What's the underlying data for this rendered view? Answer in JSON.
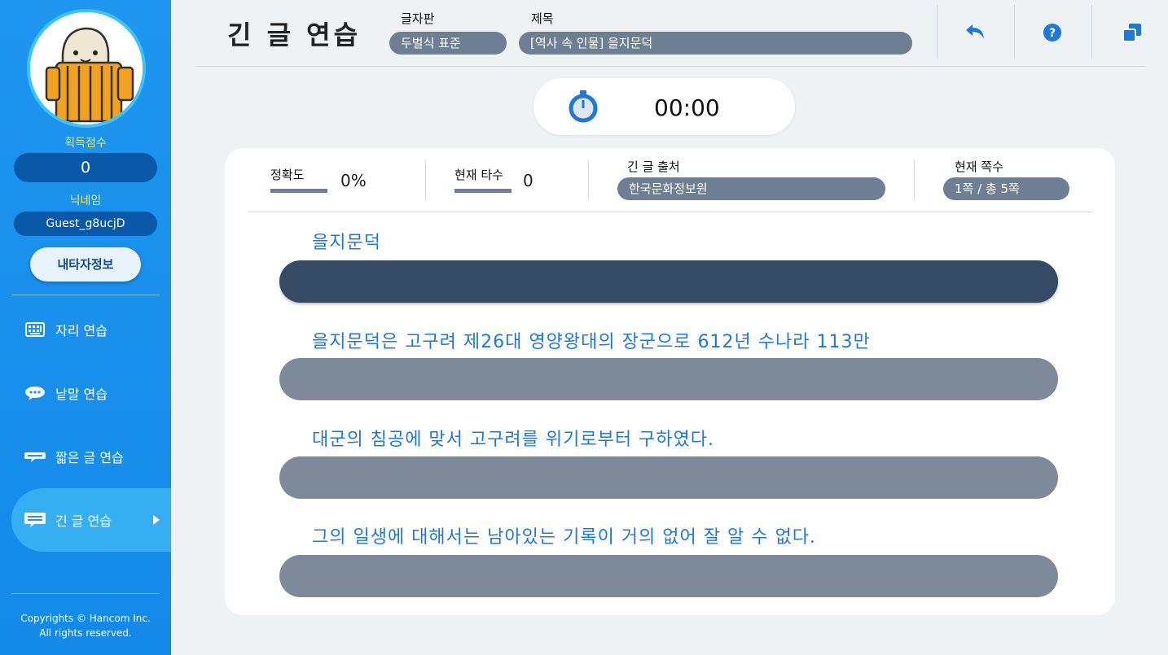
{
  "sidebar": {
    "score_label": "획득점수",
    "score_value": "0",
    "nick_label": "닉네임",
    "nick_value": "Guest_g8ucjD",
    "myinfo_label": "내타자정보",
    "nav": [
      {
        "label": "자리 연습",
        "icon": "keyboard-icon"
      },
      {
        "label": "낱말 연습",
        "icon": "speech-bubble-icon"
      },
      {
        "label": "짧은 글 연습",
        "icon": "short-text-icon"
      },
      {
        "label": "긴 글 연습",
        "icon": "long-text-icon",
        "active": true
      }
    ],
    "copyright_line1": "Copyrights © Hancom Inc.",
    "copyright_line2": "All rights reserved."
  },
  "header": {
    "title": "긴 글 연습",
    "keyboard_label": "글자판",
    "keyboard_value": "두벌식 표준",
    "subject_label": "제목",
    "subject_value": "[역사 속 인물] 을지문덕",
    "buttons": [
      "back-icon",
      "help-icon",
      "window-icon"
    ]
  },
  "timer": {
    "value": "00:00"
  },
  "stats": {
    "accuracy_label": "정확도",
    "accuracy_value": "0%",
    "speed_label": "현재 타수",
    "speed_value": "0",
    "source_label": "긴 글 출처",
    "source_value": "한국문화정보원",
    "page_label": "현재 쪽수",
    "page_value": "1쪽 / 총 5쪽"
  },
  "lines": [
    {
      "text": "을지문덕",
      "input": ""
    },
    {
      "text": "을지문덕은 고구려 제26대 영양왕대의 장군으로 612년 수나라 113만",
      "input": ""
    },
    {
      "text": "대군의 침공에 맞서 고구려를 위기로부터 구하였다.",
      "input": ""
    },
    {
      "text": "그의 일생에 대해서는 남아있는 기록이 거의 없어 잘 알 수 없다.",
      "input": ""
    }
  ],
  "colors": {
    "sidebar": "#1e96f0",
    "accent_text": "#1e79d8",
    "pill": "#6f7f93",
    "active_input": "#354a65"
  }
}
